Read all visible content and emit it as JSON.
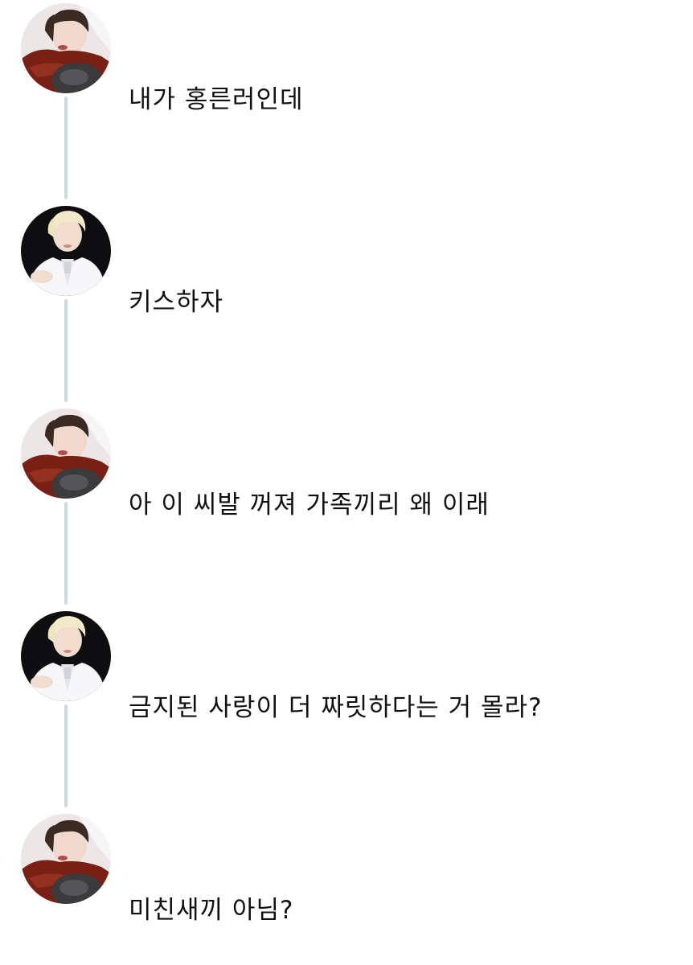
{
  "thread": {
    "tweets": [
      {
        "avatar": "avatar-red-sweater",
        "text": "내가 홍른러인데"
      },
      {
        "avatar": "avatar-white-suit",
        "text": "키스하자"
      },
      {
        "avatar": "avatar-red-sweater",
        "text": "아 이 씨발 꺼져 가족끼리 왜 이래"
      },
      {
        "avatar": "avatar-white-suit",
        "text": "금지된 사랑이 더 짜릿하다는 거 몰라?"
      },
      {
        "avatar": "avatar-red-sweater",
        "text": "미친새끼 아님?"
      }
    ]
  },
  "colors": {
    "connector": "#cfd9de",
    "text": "#111111",
    "background": "#ffffff"
  }
}
